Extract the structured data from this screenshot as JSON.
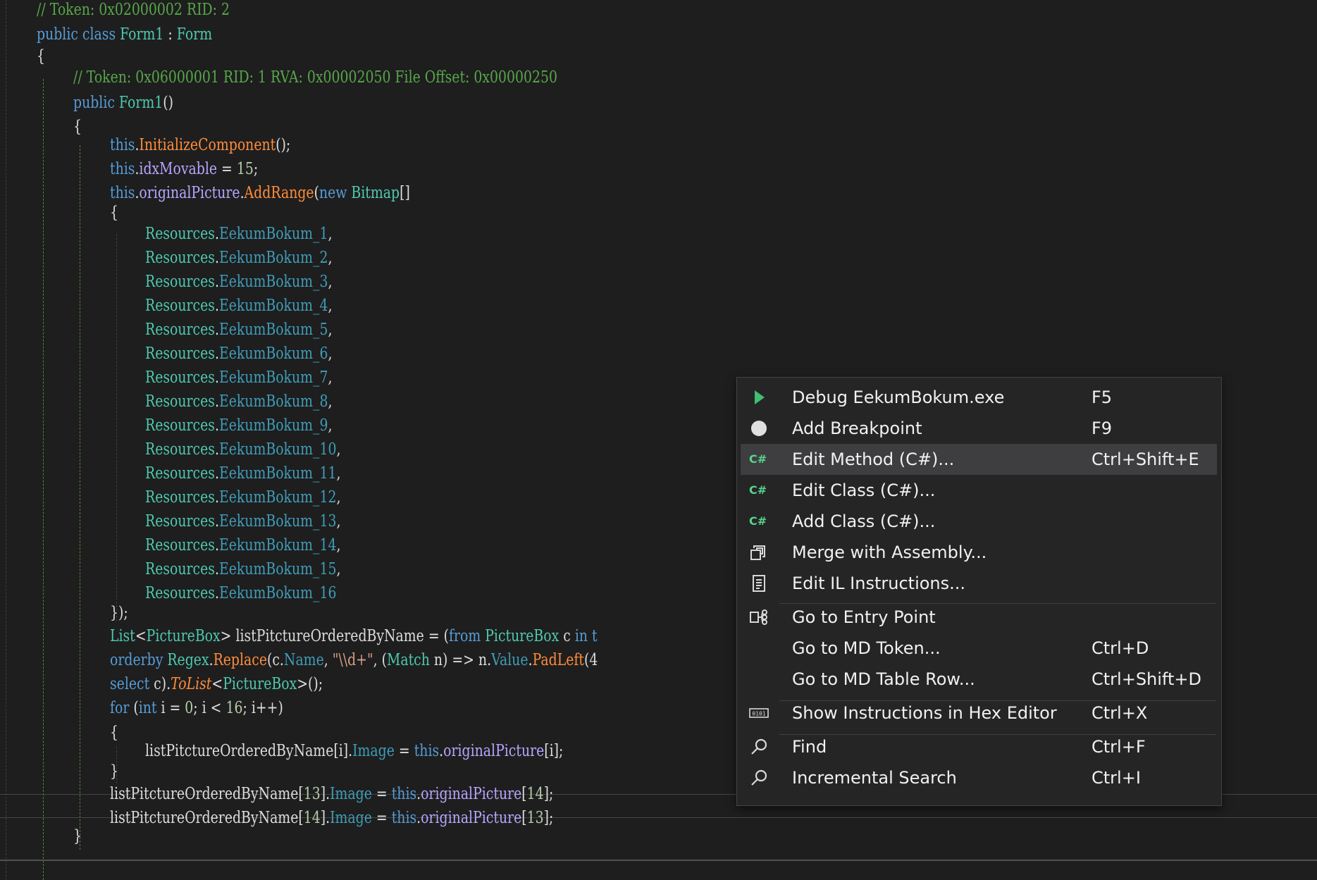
{
  "code": {
    "lines": [
      {
        "ind": 1,
        "seg": [
          [
            "// Token: 0x02000002 RID: 2",
            "cmt"
          ]
        ]
      },
      {
        "ind": 1,
        "seg": [
          [
            "public",
            "kw"
          ],
          [
            " "
          ],
          [
            "class",
            "kw"
          ],
          [
            " "
          ],
          [
            "Form1",
            "type"
          ],
          [
            " : "
          ],
          [
            "Form",
            "type"
          ]
        ]
      },
      {
        "ind": 1,
        "seg": [
          [
            "{"
          ]
        ]
      },
      {
        "ind": 2,
        "seg": [
          [
            "// Token: 0x06000001 RID: 1 RVA: 0x00002050 File Offset: 0x00000250",
            "cmt"
          ]
        ]
      },
      {
        "ind": 2,
        "seg": [
          [
            "public",
            "kw"
          ],
          [
            " "
          ],
          [
            "Form1",
            "type"
          ],
          [
            "()"
          ]
        ]
      },
      {
        "ind": 2,
        "seg": [
          [
            "{"
          ]
        ]
      },
      {
        "ind": 3,
        "seg": [
          [
            "this",
            "kw"
          ],
          [
            "."
          ],
          [
            "InitializeComponent",
            "mth"
          ],
          [
            "();"
          ]
        ]
      },
      {
        "ind": 3,
        "seg": [
          [
            "this",
            "kw"
          ],
          [
            "."
          ],
          [
            "idxMovable",
            "fld"
          ],
          [
            " = "
          ],
          [
            "15",
            "num"
          ],
          [
            ";"
          ]
        ]
      },
      {
        "ind": 3,
        "seg": [
          [
            "this",
            "kw"
          ],
          [
            "."
          ],
          [
            "originalPicture",
            "fld"
          ],
          [
            "."
          ],
          [
            "AddRange",
            "mth"
          ],
          [
            "("
          ],
          [
            "new",
            "kw"
          ],
          [
            " "
          ],
          [
            "Bitmap",
            "type"
          ],
          [
            "[]"
          ]
        ]
      },
      {
        "ind": 3,
        "seg": [
          [
            "{"
          ]
        ]
      },
      {
        "ind": 4,
        "seg": [
          [
            "Resources",
            "type"
          ],
          [
            "."
          ],
          [
            "EekumBokum_1",
            "prop"
          ],
          [
            ","
          ]
        ]
      },
      {
        "ind": 4,
        "seg": [
          [
            "Resources",
            "type"
          ],
          [
            "."
          ],
          [
            "EekumBokum_2",
            "prop"
          ],
          [
            ","
          ]
        ]
      },
      {
        "ind": 4,
        "seg": [
          [
            "Resources",
            "type"
          ],
          [
            "."
          ],
          [
            "EekumBokum_3",
            "prop"
          ],
          [
            ","
          ]
        ]
      },
      {
        "ind": 4,
        "seg": [
          [
            "Resources",
            "type"
          ],
          [
            "."
          ],
          [
            "EekumBokum_4",
            "prop"
          ],
          [
            ","
          ]
        ]
      },
      {
        "ind": 4,
        "seg": [
          [
            "Resources",
            "type"
          ],
          [
            "."
          ],
          [
            "EekumBokum_5",
            "prop"
          ],
          [
            ","
          ]
        ]
      },
      {
        "ind": 4,
        "seg": [
          [
            "Resources",
            "type"
          ],
          [
            "."
          ],
          [
            "EekumBokum_6",
            "prop"
          ],
          [
            ","
          ]
        ]
      },
      {
        "ind": 4,
        "seg": [
          [
            "Resources",
            "type"
          ],
          [
            "."
          ],
          [
            "EekumBokum_7",
            "prop"
          ],
          [
            ","
          ]
        ]
      },
      {
        "ind": 4,
        "seg": [
          [
            "Resources",
            "type"
          ],
          [
            "."
          ],
          [
            "EekumBokum_8",
            "prop"
          ],
          [
            ","
          ]
        ]
      },
      {
        "ind": 4,
        "seg": [
          [
            "Resources",
            "type"
          ],
          [
            "."
          ],
          [
            "EekumBokum_9",
            "prop"
          ],
          [
            ","
          ]
        ]
      },
      {
        "ind": 4,
        "seg": [
          [
            "Resources",
            "type"
          ],
          [
            "."
          ],
          [
            "EekumBokum_10",
            "prop"
          ],
          [
            ","
          ]
        ]
      },
      {
        "ind": 4,
        "seg": [
          [
            "Resources",
            "type"
          ],
          [
            "."
          ],
          [
            "EekumBokum_11",
            "prop"
          ],
          [
            ","
          ]
        ]
      },
      {
        "ind": 4,
        "seg": [
          [
            "Resources",
            "type"
          ],
          [
            "."
          ],
          [
            "EekumBokum_12",
            "prop"
          ],
          [
            ","
          ]
        ]
      },
      {
        "ind": 4,
        "seg": [
          [
            "Resources",
            "type"
          ],
          [
            "."
          ],
          [
            "EekumBokum_13",
            "prop"
          ],
          [
            ","
          ]
        ]
      },
      {
        "ind": 4,
        "seg": [
          [
            "Resources",
            "type"
          ],
          [
            "."
          ],
          [
            "EekumBokum_14",
            "prop"
          ],
          [
            ","
          ]
        ]
      },
      {
        "ind": 4,
        "seg": [
          [
            "Resources",
            "type"
          ],
          [
            "."
          ],
          [
            "EekumBokum_15",
            "prop"
          ],
          [
            ","
          ]
        ]
      },
      {
        "ind": 4,
        "seg": [
          [
            "Resources",
            "type"
          ],
          [
            "."
          ],
          [
            "EekumBokum_16",
            "prop"
          ]
        ]
      },
      {
        "ind": 3,
        "seg": [
          [
            "});"
          ]
        ]
      },
      {
        "ind": 3,
        "seg": [
          [
            "List",
            "type"
          ],
          [
            "<"
          ],
          [
            "PictureBox",
            "type"
          ],
          [
            "> listPitctureOrderedByName = ("
          ],
          [
            "from",
            "kw"
          ],
          [
            " "
          ],
          [
            "PictureBox",
            "type"
          ],
          [
            " c "
          ],
          [
            "in",
            "kw"
          ],
          [
            " t",
            "kw"
          ]
        ]
      },
      {
        "ind": 3,
        "seg": [
          [
            "orderby",
            "kw"
          ],
          [
            " "
          ],
          [
            "Regex",
            "type"
          ],
          [
            "."
          ],
          [
            "Replace",
            "mth"
          ],
          [
            "(c."
          ],
          [
            "Name",
            "prop"
          ],
          [
            ", "
          ],
          [
            "\"\\\\d+\"",
            "str"
          ],
          [
            ", ("
          ],
          [
            "Match",
            "type"
          ],
          [
            " n) => n."
          ],
          [
            "Value",
            "prop"
          ],
          [
            "."
          ],
          [
            "PadLeft",
            "mth"
          ],
          [
            "(4"
          ]
        ]
      },
      {
        "ind": 3,
        "seg": [
          [
            "select",
            "kw"
          ],
          [
            " c)."
          ],
          [
            "ToList",
            "ext"
          ],
          [
            "<"
          ],
          [
            "PictureBox",
            "type"
          ],
          [
            ">();"
          ]
        ]
      },
      {
        "ind": 3,
        "seg": [
          [
            "for",
            "kw"
          ],
          [
            " ("
          ],
          [
            "int",
            "kw"
          ],
          [
            " i = "
          ],
          [
            "0",
            "num"
          ],
          [
            "; i < "
          ],
          [
            "16",
            "num"
          ],
          [
            "; i++)"
          ]
        ]
      },
      {
        "ind": 3,
        "seg": [
          [
            "{"
          ]
        ]
      },
      {
        "ind": 4,
        "seg": [
          [
            "listPitctureOrderedByName[i]."
          ],
          [
            "Image",
            "prop"
          ],
          [
            " = "
          ],
          [
            "this",
            "kw"
          ],
          [
            "."
          ],
          [
            "originalPicture",
            "fld"
          ],
          [
            "[i];"
          ]
        ]
      },
      {
        "ind": 3,
        "seg": [
          [
            "}"
          ]
        ]
      },
      {
        "ind": 3,
        "seg": [
          [
            "listPitctureOrderedByName["
          ],
          [
            "13",
            "num"
          ],
          [
            "]."
          ],
          [
            "Image",
            "prop"
          ],
          [
            " = "
          ],
          [
            "this",
            "kw"
          ],
          [
            "."
          ],
          [
            "originalPicture",
            "fld"
          ],
          [
            "["
          ],
          [
            "14",
            "num"
          ],
          [
            "];"
          ]
        ]
      },
      {
        "ind": 3,
        "seg": [
          [
            "listPitctureOrderedByName["
          ],
          [
            "14",
            "num"
          ],
          [
            "]."
          ],
          [
            "Image",
            "prop"
          ],
          [
            " = "
          ],
          [
            "this",
            "kw"
          ],
          [
            "."
          ],
          [
            "originalPicture",
            "fld"
          ],
          [
            "["
          ],
          [
            "13",
            "num"
          ],
          [
            "];"
          ]
        ]
      },
      {
        "ind": 2,
        "seg": [
          [
            "}"
          ]
        ]
      }
    ]
  },
  "context_menu": {
    "items": [
      {
        "icon": "play-icon",
        "label": "Debug EekumBokum.exe",
        "shortcut": "F5"
      },
      {
        "icon": "breakpoint-icon",
        "label": "Add Breakpoint",
        "shortcut": "F9",
        "sep_after": true
      },
      {
        "icon": "csharp-icon",
        "label": "Edit Method (C#)...",
        "shortcut": "Ctrl+Shift+E",
        "hover": true
      },
      {
        "icon": "csharp-icon",
        "label": "Edit Class (C#)...",
        "shortcut": ""
      },
      {
        "icon": "csharp-icon",
        "label": "Add Class (C#)...",
        "shortcut": ""
      },
      {
        "icon": "merge-assembly-icon",
        "label": "Merge with Assembly...",
        "shortcut": ""
      },
      {
        "icon": "il-instructions-icon",
        "label": "Edit IL Instructions...",
        "shortcut": "",
        "sep_after": true
      },
      {
        "icon": "entry-point-icon",
        "label": "Go to Entry Point",
        "shortcut": ""
      },
      {
        "icon": "",
        "label": "Go to MD Token...",
        "shortcut": "Ctrl+D"
      },
      {
        "icon": "",
        "label": "Go to MD Table Row...",
        "shortcut": "Ctrl+Shift+D",
        "sep_after": true
      },
      {
        "icon": "hex-editor-icon",
        "label": "Show Instructions in Hex Editor",
        "shortcut": "Ctrl+X",
        "sep_after": true
      },
      {
        "icon": "find-icon",
        "label": "Find",
        "shortcut": "Ctrl+F"
      },
      {
        "icon": "incremental-search-icon",
        "label": "Incremental Search",
        "shortcut": "Ctrl+I"
      }
    ],
    "csharp_badge": "C#"
  },
  "colors": {
    "background": "#1e1e1e",
    "keyword": "#569cd6",
    "type": "#4ec9b0",
    "comment": "#57a64a",
    "method": "#ff8c3c",
    "field": "#b8a4ff",
    "property": "#3f9db8",
    "menu_background": "#252526",
    "menu_hover": "#3e3e40",
    "play_green": "#3fbf6f"
  }
}
